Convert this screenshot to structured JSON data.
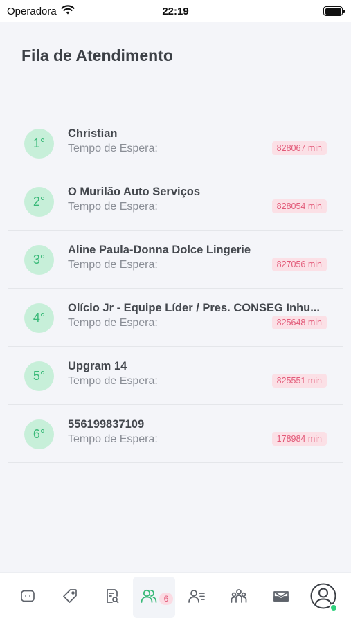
{
  "status_bar": {
    "carrier": "Operadora",
    "time": "22:19"
  },
  "header": {
    "title": "Fila de Atendimento"
  },
  "queue": [
    {
      "position": "1°",
      "name": "Christian",
      "wait_label": "Tempo de Espera:",
      "wait_time": "828067 min"
    },
    {
      "position": "2°",
      "name": "O Murilão Auto Serviços",
      "wait_label": "Tempo de Espera:",
      "wait_time": "828054 min"
    },
    {
      "position": "3°",
      "name": "Aline Paula-Donna Dolce Lingerie",
      "wait_label": "Tempo de Espera:",
      "wait_time": "827056 min"
    },
    {
      "position": "4°",
      "name": "Olício Jr - Equipe Líder / Pres. CONSEG Inhu...",
      "wait_label": "Tempo de Espera:",
      "wait_time": "825648 min"
    },
    {
      "position": "5°",
      "name": "Upgram 14",
      "wait_label": "Tempo de Espera:",
      "wait_time": "825551 min"
    },
    {
      "position": "6°",
      "name": "556199837109",
      "wait_label": "Tempo de Espera:",
      "wait_time": "178984 min"
    }
  ],
  "bottom_nav": {
    "items": [
      {
        "icon": "chat-icon"
      },
      {
        "icon": "tag-icon"
      },
      {
        "icon": "document-search-icon"
      },
      {
        "icon": "queue-users-icon",
        "badge": "6",
        "active": true
      },
      {
        "icon": "user-list-icon"
      },
      {
        "icon": "group-icon"
      },
      {
        "icon": "inbox-icon"
      },
      {
        "icon": "profile-avatar-icon"
      }
    ]
  },
  "colors": {
    "accent_green": "#39b978",
    "badge_green_bg": "#c7efd9",
    "wait_badge_bg": "#fbe0e6",
    "wait_badge_text": "#e25a79",
    "online_status": "#2fd07c"
  }
}
